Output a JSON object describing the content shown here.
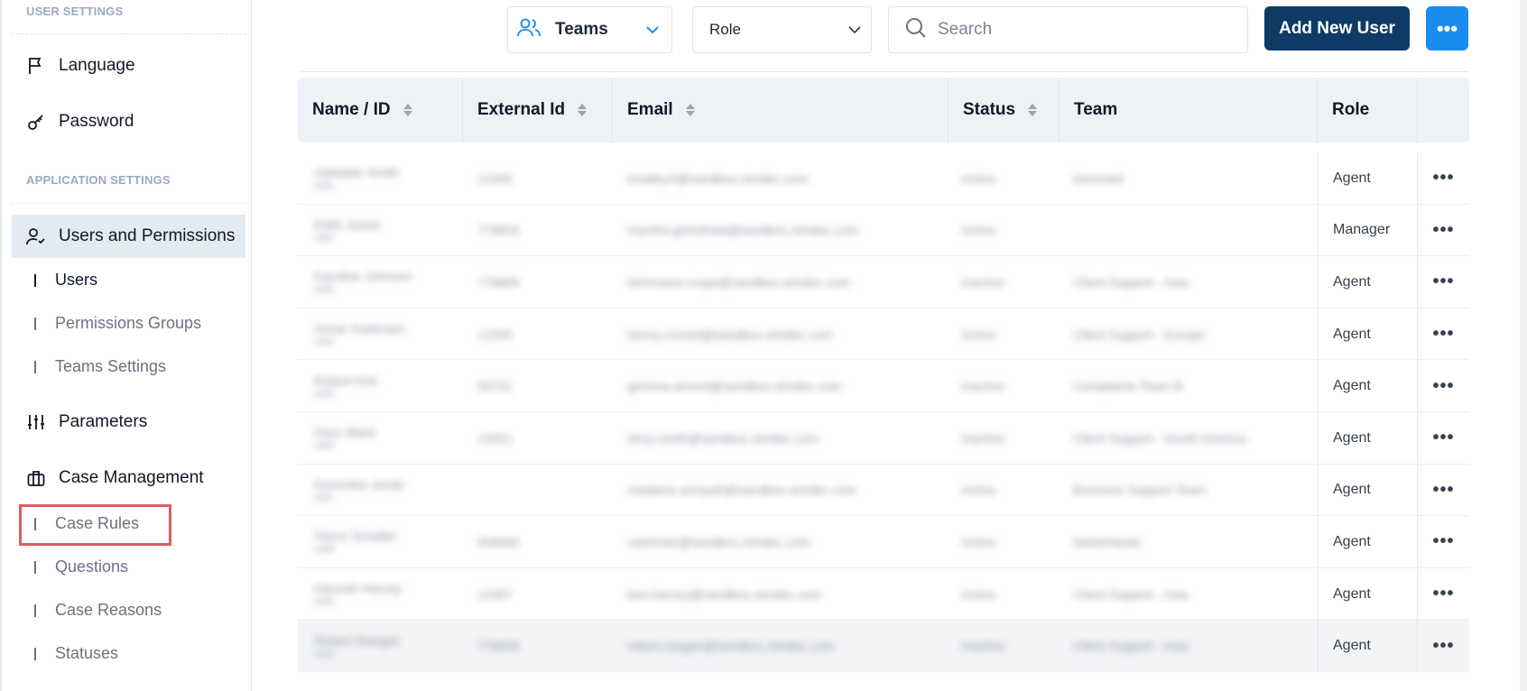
{
  "sidebar": {
    "user_settings_label": "USER SETTINGS",
    "application_settings_label": "APPLICATION SETTINGS",
    "language": "Language",
    "password": "Password",
    "users_and_permissions": "Users and Permissions",
    "sub_users": "Users",
    "sub_permissions_groups": "Permissions Groups",
    "sub_teams_settings": "Teams Settings",
    "parameters": "Parameters",
    "case_management": "Case Management",
    "sub_case_rules": "Case Rules",
    "sub_questions": "Questions",
    "sub_case_reasons": "Case Reasons",
    "sub_statuses": "Statuses"
  },
  "toolbar": {
    "teams_label": "Teams",
    "role_label": "Role",
    "search_placeholder": "Search",
    "add_user_label": "Add New User",
    "more_label": "•••"
  },
  "table": {
    "headers": {
      "name": "Name / ID",
      "external_id": "External Id",
      "email": "Email",
      "status": "Status",
      "team": "Team",
      "role": "Role"
    },
    "rows": [
      {
        "name": "Adelaide Smith",
        "sub": "1001",
        "ext": "12345",
        "email": "bradley.ll@sandbox.simdec.com",
        "status": "Active",
        "team": "Denmark",
        "role": "Agent",
        "actions": "•••"
      },
      {
        "name": "Edith Junior",
        "sub": "1002",
        "ext": "778654",
        "email": "marsha.grimshaw@sandbox.simdec.com",
        "status": "Active",
        "team": "",
        "role": "Manager",
        "actions": "•••"
      },
      {
        "name": "Karoline Johnson",
        "sub": "1003",
        "ext": "778865",
        "email": "hehrmann.crops@sandbox.simdec.com",
        "status": "Inactive",
        "team": "Client Support - Asia",
        "role": "Agent",
        "actions": "•••"
      },
      {
        "name": "Annar Andersen",
        "sub": "1004",
        "ext": "12345",
        "email": "henny.cronist@sandbox.simdec.com",
        "status": "Active",
        "team": "Client Support - Europe",
        "role": "Agent",
        "actions": "•••"
      },
      {
        "name": "Robert Kint",
        "sub": "1005",
        "ext": "56721",
        "email": "gemma.simont@sandbox.simdec.com",
        "status": "Inactive",
        "team": "Complaints Team B",
        "role": "Agent",
        "actions": "•••"
      },
      {
        "name": "Gary Ward",
        "sub": "1006",
        "ext": "13421",
        "email": "elroy.smith@sandbox.simdec.com",
        "status": "Inactive",
        "team": "Client Support - South America",
        "role": "Agent",
        "actions": "•••"
      },
      {
        "name": "Dominika Jendo",
        "sub": "1007",
        "ext": "",
        "email": "madame.sorayah@sandbox.simdec.com",
        "status": "Active",
        "team": "Business Support Team",
        "role": "Agent",
        "actions": "•••"
      },
      {
        "name": "Pierre Schaller",
        "sub": "1008",
        "ext": "908080",
        "email": "cashman@sandbox.simdec.com",
        "status": "Active",
        "team": "Netherlands",
        "role": "Agent",
        "actions": "•••"
      },
      {
        "name": "Hannah Harvey",
        "sub": "1009",
        "ext": "12367",
        "email": "ben.harvey@sandbox.simdec.com",
        "status": "Active",
        "team": "Client Support - Asia",
        "role": "Agent",
        "actions": "•••"
      },
      {
        "name": "Robert Reegan",
        "sub": "1010",
        "ext": "778655",
        "email": "robert.reegan@sandbox.simdec.com",
        "status": "Inactive",
        "team": "Client Support - Asia",
        "role": "Agent",
        "actions": "•••"
      }
    ]
  },
  "colors": {
    "primary_dark": "#0d3b66",
    "primary_blue": "#1a8cf0",
    "highlight_red": "#e25a5f"
  }
}
